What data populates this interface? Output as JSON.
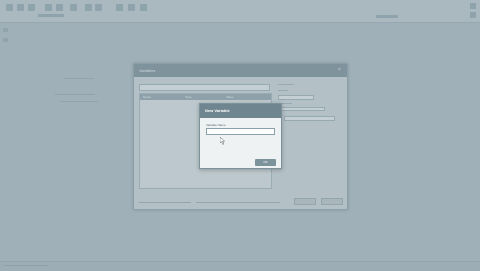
{
  "main_dialog": {
    "title": "Variables",
    "close_glyph": "×",
    "table_columns": [
      "Name",
      "Type",
      "Value"
    ],
    "footer_note": "",
    "ok_label": "",
    "cancel_label": ""
  },
  "new_variable_dialog": {
    "title": "New Variable",
    "name_label": "Variable Name",
    "name_value": "",
    "ok_label": "OK"
  },
  "icons": {
    "cursor": "mouse-pointer-icon"
  }
}
